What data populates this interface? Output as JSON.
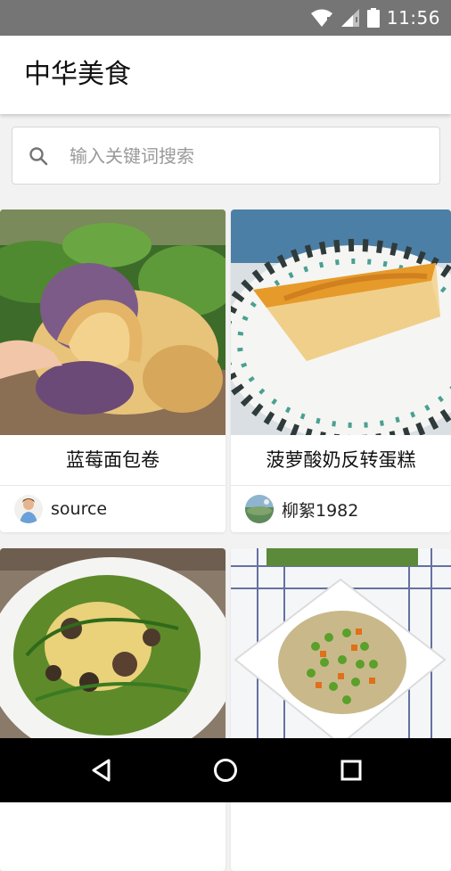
{
  "status_bar": {
    "time": "11:56",
    "icons": [
      "wifi-icon",
      "signal-icon",
      "battery-icon"
    ]
  },
  "app_bar": {
    "title": "中华美食"
  },
  "search": {
    "placeholder": "输入关键词搜索",
    "icon": "search-icon"
  },
  "recipes": [
    {
      "title": "蓝莓面包卷",
      "author": "source"
    },
    {
      "title": "菠萝酸奶反转蛋糕",
      "author": "柳絮1982"
    },
    {
      "title": "",
      "author": ""
    },
    {
      "title": "",
      "author": ""
    }
  ],
  "nav_bar": {
    "buttons": [
      "back-icon",
      "home-icon",
      "recents-icon"
    ]
  },
  "colors": {
    "status_bar": "#757575",
    "app_bar": "#ffffff",
    "background": "#f2f2f2",
    "nav_bar": "#000000"
  }
}
